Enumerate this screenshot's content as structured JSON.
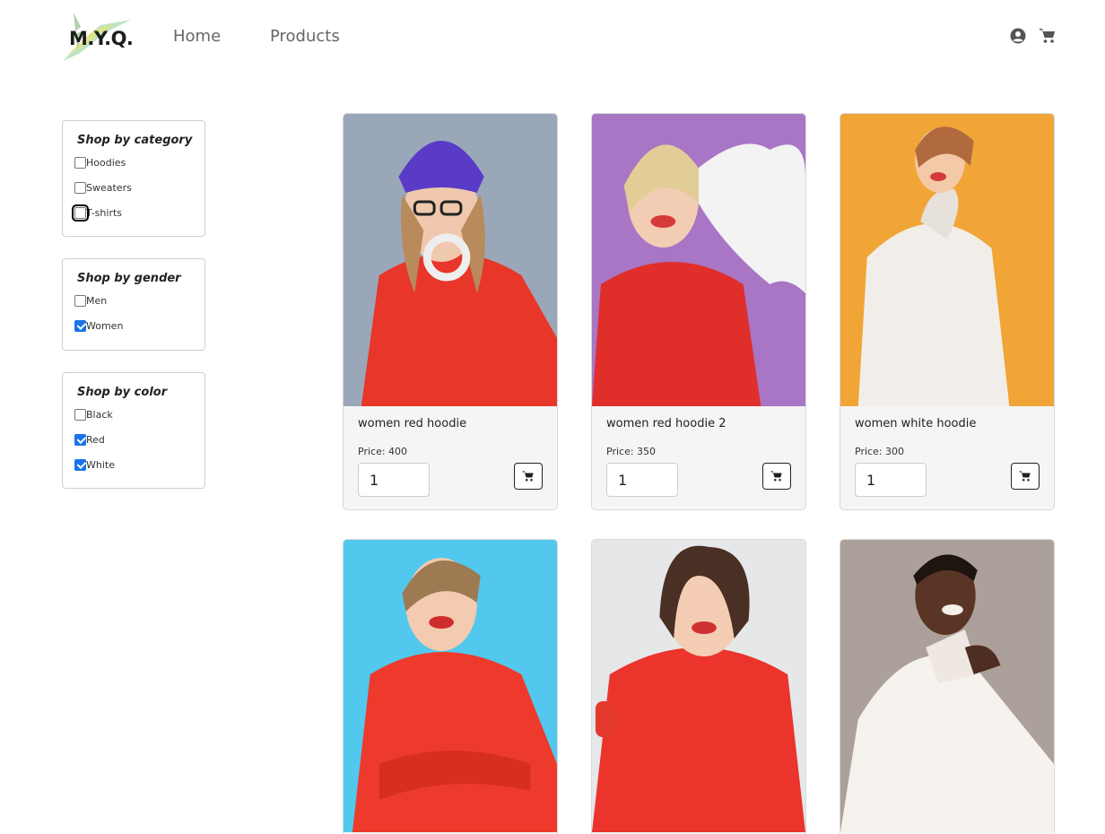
{
  "brand": {
    "logo_text": "M.Y.Q."
  },
  "nav": {
    "home": "Home",
    "products": "Products"
  },
  "header_icons": {
    "account": "account-circle-icon",
    "cart": "shopping-cart-icon"
  },
  "filters": {
    "category": {
      "title": "Shop by category",
      "options": [
        {
          "label": "Hoodies",
          "checked": false
        },
        {
          "label": "Sweaters",
          "checked": false
        },
        {
          "label": "T-shirts",
          "checked": false
        }
      ]
    },
    "gender": {
      "title": "Shop by gender",
      "options": [
        {
          "label": "Men",
          "checked": false
        },
        {
          "label": "Women",
          "checked": true
        }
      ]
    },
    "color": {
      "title": "Shop by color",
      "options": [
        {
          "label": "Black",
          "checked": false
        },
        {
          "label": "Red",
          "checked": true
        },
        {
          "label": "White",
          "checked": true
        }
      ]
    }
  },
  "products": [
    {
      "name": "women red hoodie",
      "price": "Price: 400",
      "qty": "1",
      "bg": "#9aa7b8",
      "garment": "#e8362a"
    },
    {
      "name": "women red hoodie 2",
      "price": "Price: 350",
      "qty": "1",
      "bg": "#a876c4",
      "garment": "#e02e2b"
    },
    {
      "name": "women white hoodie",
      "price": "Price: 300",
      "qty": "1",
      "bg": "#f0a536",
      "garment": "#f1eeea"
    },
    {
      "name": "",
      "price": "",
      "qty": "",
      "bg": "#52c8ee",
      "garment": "#ee3a2c"
    },
    {
      "name": "",
      "price": "",
      "qty": "",
      "bg": "#e6e7e9",
      "garment": "#ea342c"
    },
    {
      "name": "",
      "price": "",
      "qty": "",
      "bg": "#aca19a",
      "garment": "#f6f2ee"
    }
  ],
  "colors": {
    "accent": "#1a73e8",
    "card_bg": "#f5f5f5"
  }
}
